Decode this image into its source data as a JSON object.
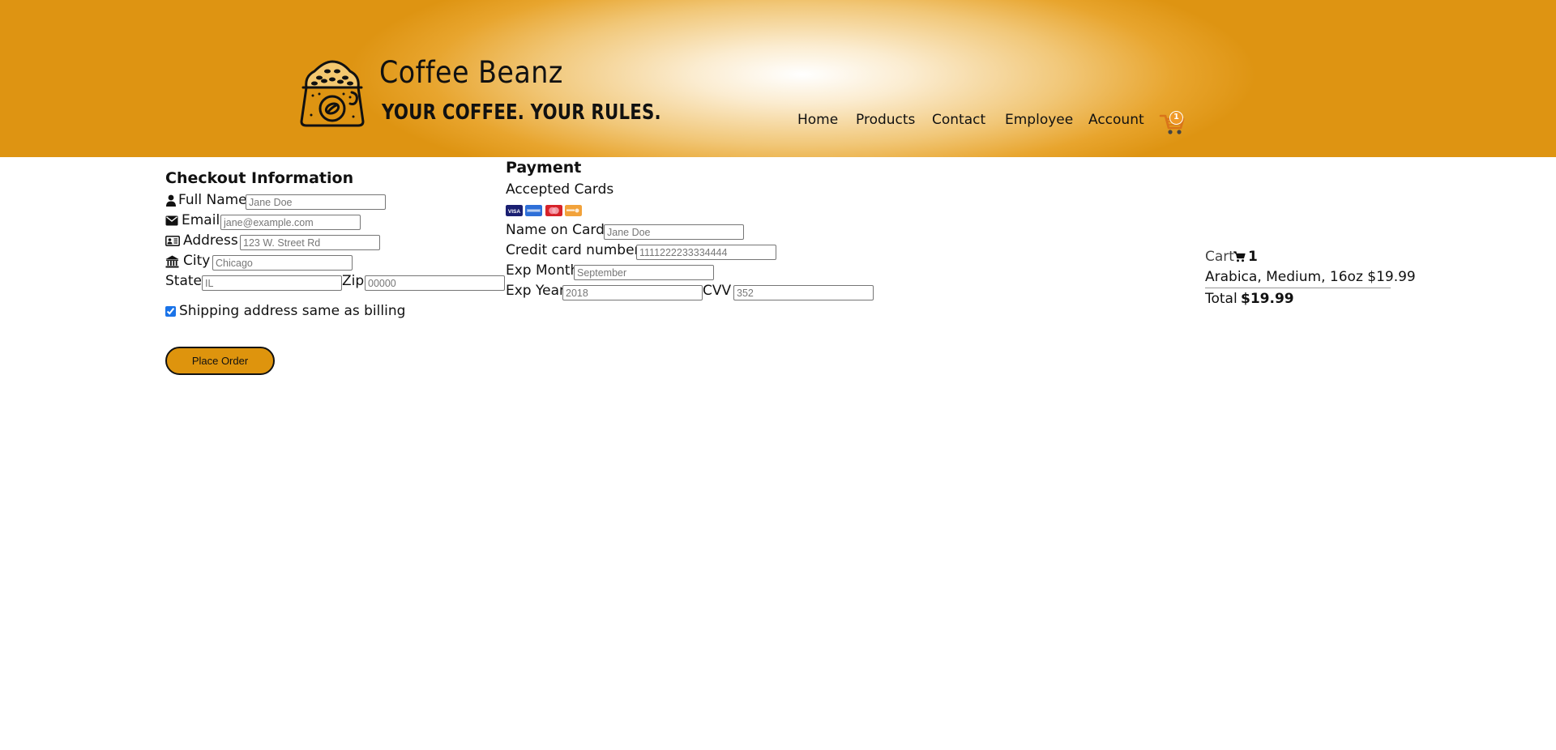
{
  "header": {
    "brand_name": "Coffee Beanz",
    "tagline": "YOUR COFFEE. YOUR RULES.",
    "nav": [
      {
        "label": "Home"
      },
      {
        "label": "Products"
      },
      {
        "label": "Contact"
      },
      {
        "label": "Employee"
      },
      {
        "label": "Account"
      }
    ],
    "cart_icon": "shopping-cart-icon",
    "cart_badge": "1",
    "colors": {
      "gradient_outer": "#de9412",
      "gradient_center": "#ffffff",
      "badge": "#f09a28"
    }
  },
  "checkout": {
    "title": "Checkout Information",
    "full_name": {
      "label": "Full Name",
      "placeholder": "Jane Doe",
      "icon": "user-icon"
    },
    "email": {
      "label": "Email",
      "placeholder": "jane@example.com",
      "icon": "envelope-icon"
    },
    "address": {
      "label": "Address",
      "placeholder": "123 W. Street Rd",
      "icon": "address-card-icon"
    },
    "city": {
      "label": "City",
      "placeholder": "Chicago",
      "icon": "institution-icon"
    },
    "state": {
      "label": "State",
      "placeholder": "IL"
    },
    "zip": {
      "label": "Zip",
      "placeholder": "00000"
    },
    "same_address_label": "Shipping address same as billing",
    "same_address_checked": true,
    "place_order_label": "Place Order",
    "button_color": "#de940d"
  },
  "payment": {
    "title": "Payment",
    "accepted_cards_label": "Accepted Cards",
    "cards": [
      "visa-icon",
      "amex-icon",
      "mastercard-icon",
      "discover-icon"
    ],
    "name_on_card": {
      "label": "Name on Card",
      "placeholder": "Jane Doe"
    },
    "card_number": {
      "label": "Credit card number",
      "placeholder": "1111222233334444"
    },
    "exp_month": {
      "label": "Exp Month",
      "placeholder": "September"
    },
    "exp_year": {
      "label": "Exp Year",
      "placeholder": "2018"
    },
    "cvv": {
      "label": "CVV",
      "placeholder": "352"
    }
  },
  "cart": {
    "label": "Cart",
    "icon": "shopping-cart-icon",
    "count": "1",
    "item": "Arabica, Medium, 16oz $19.99",
    "total_label": "Total",
    "total_value": "$19.99"
  }
}
